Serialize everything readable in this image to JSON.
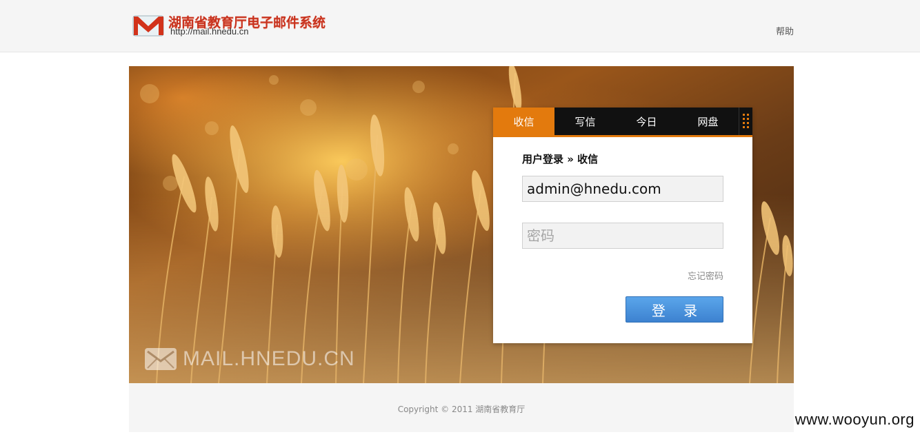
{
  "header": {
    "logo_title": "湖南省教育厅电子邮件系统",
    "logo_url": "http://mail.hnedu.cn",
    "help_label": "帮助",
    "logo_icon": "envelope-m-icon"
  },
  "hero": {
    "watermark_text": "MAIL.HNEDU.CN",
    "watermark_icon": "envelope-icon"
  },
  "login": {
    "tabs": [
      {
        "label": "收信",
        "active": true
      },
      {
        "label": "写信",
        "active": false
      },
      {
        "label": "今日",
        "active": false
      },
      {
        "label": "网盘",
        "active": false
      }
    ],
    "grip_icon": "drag-grip-icon",
    "title": "用户登录 » 收信",
    "username_value": "admin@hnedu.com",
    "password_placeholder": "密码",
    "forgot_label": "忘记密码",
    "submit_label": "登 录"
  },
  "footer": {
    "copyright": "Copyright © 2011 湖南省教育厅"
  },
  "overlay": {
    "site_watermark": "www.wooyun.org"
  },
  "colors": {
    "accent": "#e37a0d",
    "tab_bar": "#111111",
    "button": "#3d82d0",
    "logo_red": "#c8321e"
  }
}
